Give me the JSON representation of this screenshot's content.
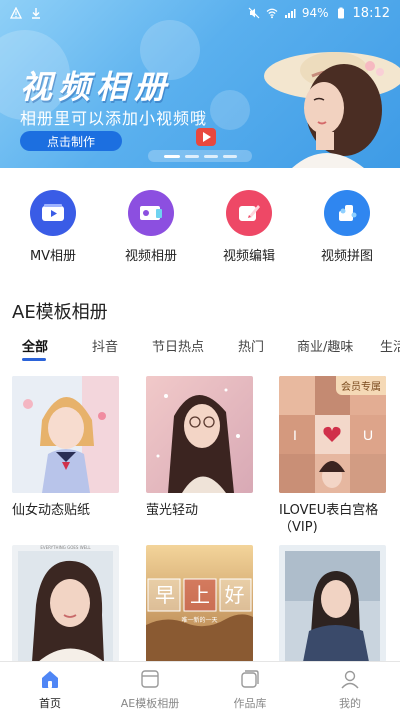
{
  "status_bar": {
    "battery": "94%",
    "time": "18:12"
  },
  "banner": {
    "title": "视频相册",
    "subtitle": "相册里可以添加小视频哦",
    "cta": "点击制作"
  },
  "actions": [
    {
      "label": "MV相册",
      "icon": "mv-album-icon",
      "color": "#3a5ce6"
    },
    {
      "label": "视频相册",
      "icon": "video-album-icon",
      "color": "#8c4fe0"
    },
    {
      "label": "视频编辑",
      "icon": "video-edit-icon",
      "color": "#ee4866"
    },
    {
      "label": "视频拼图",
      "icon": "video-collage-icon",
      "color": "#2f86f0"
    }
  ],
  "section": {
    "title": "AE模板相册"
  },
  "tabs": [
    "全部",
    "抖音",
    "节日热点",
    "热门",
    "商业/趣味",
    "生活"
  ],
  "cards": [
    {
      "name": "仙女动态贴纸"
    },
    {
      "name": "萤光轻动"
    },
    {
      "name": "ILOVEU表白宫格（VIP)",
      "badge": "会员专属"
    },
    {
      "name": ""
    },
    {
      "name": "",
      "overlay": [
        "早",
        "上",
        "好"
      ],
      "caption": "唯一新的一天"
    },
    {
      "name": ""
    }
  ],
  "card4_caption": "EVERYTHING GOES WELL",
  "bottom_nav": [
    {
      "label": "首页",
      "icon": "home-icon"
    },
    {
      "label": "AE模板相册",
      "icon": "template-icon"
    },
    {
      "label": "作品库",
      "icon": "works-icon"
    },
    {
      "label": "我的",
      "icon": "profile-icon"
    }
  ],
  "colors": {
    "accent": "#2b63d9",
    "banner_btn": "#1c6fe0"
  }
}
